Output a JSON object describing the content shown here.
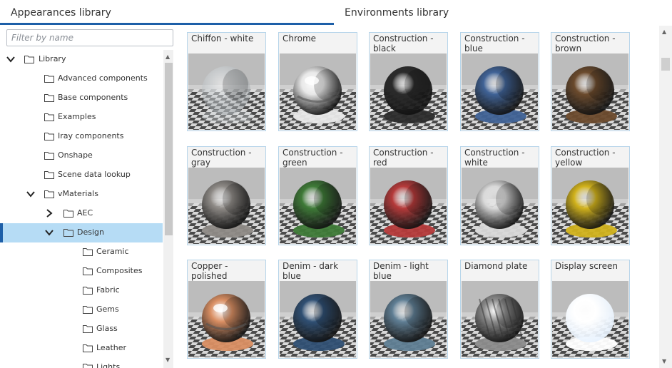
{
  "tabs": [
    {
      "label": "Appearances library",
      "active": true
    },
    {
      "label": "Environments library",
      "active": false
    }
  ],
  "filter": {
    "placeholder": "Filter by name",
    "value": ""
  },
  "tree": [
    {
      "label": "Library",
      "depth": 0,
      "expander": "down",
      "selected": false
    },
    {
      "label": "Advanced components",
      "depth": 1,
      "expander": "none",
      "selected": false
    },
    {
      "label": "Base components",
      "depth": 1,
      "expander": "none",
      "selected": false
    },
    {
      "label": "Examples",
      "depth": 1,
      "expander": "none",
      "selected": false
    },
    {
      "label": "Iray components",
      "depth": 1,
      "expander": "none",
      "selected": false
    },
    {
      "label": "Onshape",
      "depth": 1,
      "expander": "none",
      "selected": false
    },
    {
      "label": "Scene data lookup",
      "depth": 1,
      "expander": "none",
      "selected": false
    },
    {
      "label": "vMaterials",
      "depth": 1,
      "expander": "down",
      "selected": false
    },
    {
      "label": "AEC",
      "depth": 2,
      "expander": "right",
      "selected": false
    },
    {
      "label": "Design",
      "depth": 2,
      "expander": "down",
      "selected": true
    },
    {
      "label": "Ceramic",
      "depth": 3,
      "expander": "none",
      "selected": false
    },
    {
      "label": "Composites",
      "depth": 3,
      "expander": "none",
      "selected": false
    },
    {
      "label": "Fabric",
      "depth": 3,
      "expander": "none",
      "selected": false
    },
    {
      "label": "Gems",
      "depth": 3,
      "expander": "none",
      "selected": false
    },
    {
      "label": "Glass",
      "depth": 3,
      "expander": "none",
      "selected": false
    },
    {
      "label": "Leather",
      "depth": 3,
      "expander": "none",
      "selected": false
    },
    {
      "label": "Lights",
      "depth": 3,
      "expander": "none",
      "selected": false
    }
  ],
  "materials": [
    {
      "name": "Chiffon - white",
      "color": "#d8dde0",
      "style": "transparent"
    },
    {
      "name": "Chrome",
      "color": "#e8e8e8",
      "style": "chrome"
    },
    {
      "name": "Construction - black",
      "color": "#2b2b2b",
      "style": "matte"
    },
    {
      "name": "Construction - blue",
      "color": "#3f6296",
      "style": "matte"
    },
    {
      "name": "Construction - brown",
      "color": "#6b4a2c",
      "style": "matte"
    },
    {
      "name": "Construction - gray",
      "color": "#8e8a86",
      "style": "matte"
    },
    {
      "name": "Construction - green",
      "color": "#3e7a37",
      "style": "matte"
    },
    {
      "name": "Construction - red",
      "color": "#b53a3a",
      "style": "matte"
    },
    {
      "name": "Construction - white",
      "color": "#d9d9d9",
      "style": "matte"
    },
    {
      "name": "Construction - yellow",
      "color": "#d1b21c",
      "style": "matte"
    },
    {
      "name": "Copper - polished",
      "color": "#d98e62",
      "style": "chrome"
    },
    {
      "name": "Denim - dark blue",
      "color": "#2f4f73",
      "style": "matte"
    },
    {
      "name": "Denim - light blue",
      "color": "#5f7e94",
      "style": "matte"
    },
    {
      "name": "Diamond plate",
      "color": "#8b8b8b",
      "style": "pattern"
    },
    {
      "name": "Display screen",
      "color": "#ffffff",
      "style": "glow"
    }
  ],
  "colors": {
    "accent": "#1d5fa8",
    "selection": "#b6dcf5",
    "tile_border": "#b7d5ea"
  }
}
